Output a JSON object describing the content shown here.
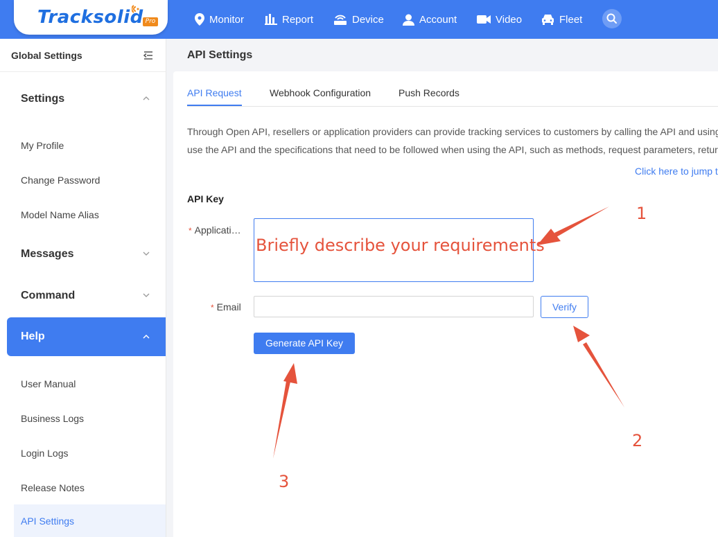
{
  "colors": {
    "brand": "#3f7cf0",
    "annotation": "#e5533c",
    "logo_pro": "#f08a1c"
  },
  "header": {
    "logo": "Tracksolid",
    "logo_badge": "Pro",
    "nav": [
      {
        "label": "Monitor",
        "icon": "location-pin-icon"
      },
      {
        "label": "Report",
        "icon": "bar-chart-icon"
      },
      {
        "label": "Device",
        "icon": "router-icon"
      },
      {
        "label": "Account",
        "icon": "user-icon"
      },
      {
        "label": "Video",
        "icon": "video-camera-icon"
      },
      {
        "label": "Fleet",
        "icon": "car-icon"
      }
    ],
    "search_icon": "search-icon"
  },
  "sidebar": {
    "title": "Global Settings",
    "groups": {
      "settings": {
        "label": "Settings",
        "items": [
          "My Profile",
          "Change Password",
          "Model Name Alias"
        ]
      },
      "messages": {
        "label": "Messages"
      },
      "command": {
        "label": "Command"
      },
      "help": {
        "label": "Help",
        "items": [
          "User Manual",
          "Business Logs",
          "Login Logs",
          "Release Notes",
          "API Settings"
        ]
      }
    }
  },
  "main": {
    "page_title": "API Settings",
    "tabs": [
      "API Request",
      "Webhook Configuration",
      "Push Records"
    ],
    "description": [
      "Through Open API, resellers or application providers can provide tracking services to customers by calling the API and using",
      "use the API and the specifications that need to be followed when using the API, such as methods, request parameters, retur"
    ],
    "link": "Click here to jump t",
    "section_title": "API Key",
    "form": {
      "application_label": "Applicati…",
      "application_placeholder": "Briefly describe your requirements",
      "email_label": "Email",
      "email_value": "",
      "required_mark": "*",
      "verify_label": "Verify",
      "generate_label": "Generate API Key"
    }
  },
  "annotations": [
    "1",
    "2",
    "3"
  ]
}
